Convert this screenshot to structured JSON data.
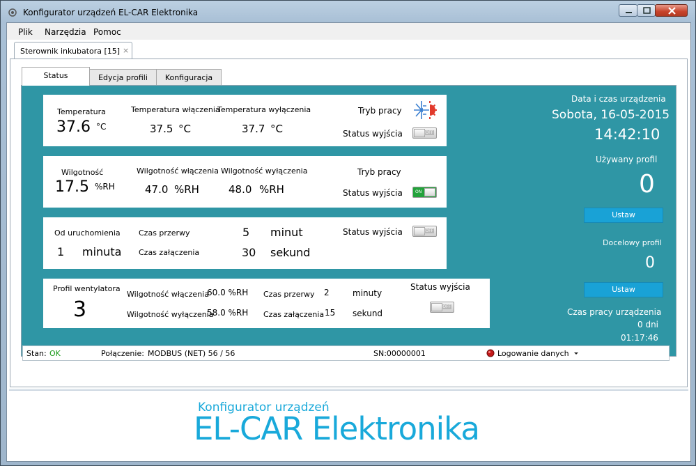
{
  "window": {
    "title": "Konfigurator urządzeń EL-CAR Elektronika"
  },
  "menu": [
    "Plik",
    "Narzędzia",
    "Pomoc"
  ],
  "doc_tab": {
    "label": "Sterownik inkubatora [15]",
    "close": "×"
  },
  "tabs": [
    "Status",
    "Edycja profili",
    "Konfiguracja"
  ],
  "temp": {
    "label": "Temperatura",
    "value": "37.6",
    "unit": "°C",
    "on_label": "Temperatura włączenia",
    "on_value": "37.5",
    "on_unit": "°C",
    "off_label": "Temperatura wyłączenia",
    "off_value": "37.7",
    "off_unit": "°C",
    "mode_label": "Tryb pracy",
    "mode_icon": "heat-cool-icon",
    "out_label": "Status wyjścia",
    "out_state": "OFF"
  },
  "hum": {
    "label": "Wilgotność",
    "value": "17.5",
    "unit": "%RH",
    "on_label": "Wilgotność włączenia",
    "on_value": "47.0",
    "on_unit": "%RH",
    "off_label": "Wilgotność wyłączenia",
    "off_value": "48.0",
    "off_unit": "%RH",
    "mode_label": "Tryb pracy",
    "out_label": "Status wyjścia",
    "out_state": "ON"
  },
  "timer": {
    "uptime_label": "Od uruchomienia",
    "uptime_value": "1",
    "uptime_unit": "minuta",
    "pause_label": "Czas przerwy",
    "pause_value": "5",
    "pause_unit": "minut",
    "on_label": "Czas załączenia",
    "on_value": "30",
    "on_unit": "sekund",
    "out_label": "Status wyjścia",
    "out_state": "OFF"
  },
  "fan": {
    "profile_label": "Profil wentylatora",
    "profile_value": "3",
    "hum_on_label": "Wilgotność włączenia",
    "hum_on_value": "60.0 %RH",
    "hum_off_label": "Wilgotność wyłączenia",
    "hum_off_value": "58.0 %RH",
    "pause_label": "Czas przerwy",
    "pause_value": "2",
    "pause_unit": "minuty",
    "on_label": "Czas załączenia",
    "on_value": "15",
    "on_unit": "sekund",
    "out_label": "Status wyjścia",
    "out_state": "OFF"
  },
  "side": {
    "datetime_label": "Data i czas urządzenia",
    "date": "Sobota,  16-05-2015",
    "time": "14:42:10",
    "used_profile_label": "Używany profil",
    "used_profile_value": "0",
    "set_button": "Ustaw",
    "target_profile_label": "Docelowy profil",
    "target_profile_value": "0",
    "set_button2": "Ustaw",
    "runtime_label": "Czas pracy urządzenia",
    "runtime_days": "0 dni",
    "runtime_time": "01:17:46"
  },
  "status": {
    "state_label": "Stan:",
    "state_value": "OK",
    "conn_label": "Połączenie:",
    "conn_value": "MODBUS (NET)  56 / 56",
    "sn": "SN:00000001",
    "logging": "Logowanie danych"
  },
  "logo": {
    "small": "Konfigurator urządzeń",
    "big": "EL-CAR Elektronika"
  },
  "colors": {
    "teal": "#2f96a5",
    "button": "#19a2d6",
    "ok": "#1a9a1a",
    "logo": "#19a9da"
  }
}
